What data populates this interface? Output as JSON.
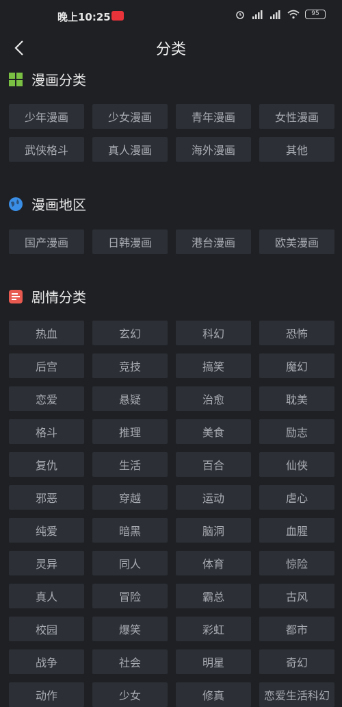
{
  "status_bar": {
    "time": "晚上10:25",
    "battery": "95"
  },
  "header": {
    "title": "分类"
  },
  "sections": {
    "manga": {
      "title": "漫画分类",
      "icon": "grid-icon",
      "items": [
        "少年漫画",
        "少女漫画",
        "青年漫画",
        "女性漫画",
        "武侠格斗",
        "真人漫画",
        "海外漫画",
        "其他"
      ]
    },
    "region": {
      "title": "漫画地区",
      "icon": "globe-icon",
      "items": [
        "国产漫画",
        "日韩漫画",
        "港台漫画",
        "欧美漫画"
      ]
    },
    "plot": {
      "title": "剧情分类",
      "icon": "list-icon",
      "items": [
        "热血",
        "玄幻",
        "科幻",
        "恐怖",
        "后宫",
        "竞技",
        "搞笑",
        "魔幻",
        "恋爱",
        "悬疑",
        "治愈",
        "耽美",
        "格斗",
        "推理",
        "美食",
        "励志",
        "复仇",
        "生活",
        "百合",
        "仙侠",
        "邪恶",
        "穿越",
        "运动",
        "虐心",
        "纯爱",
        "暗黑",
        "脑洞",
        "血腥",
        "灵异",
        "同人",
        "体育",
        "惊险",
        "真人",
        "冒险",
        "霸总",
        "古风",
        "校园",
        "爆笑",
        "彩虹",
        "都市",
        "战争",
        "社会",
        "明星",
        "奇幻",
        "动作",
        "少女",
        "修真",
        "恋爱生活科幻"
      ]
    }
  },
  "colors": {
    "background": "#1e2024",
    "chip": "#2c3036",
    "grid_icon": "#7ac143",
    "globe_icon": "#3a8ee6",
    "list_icon": "#e85a4f"
  }
}
